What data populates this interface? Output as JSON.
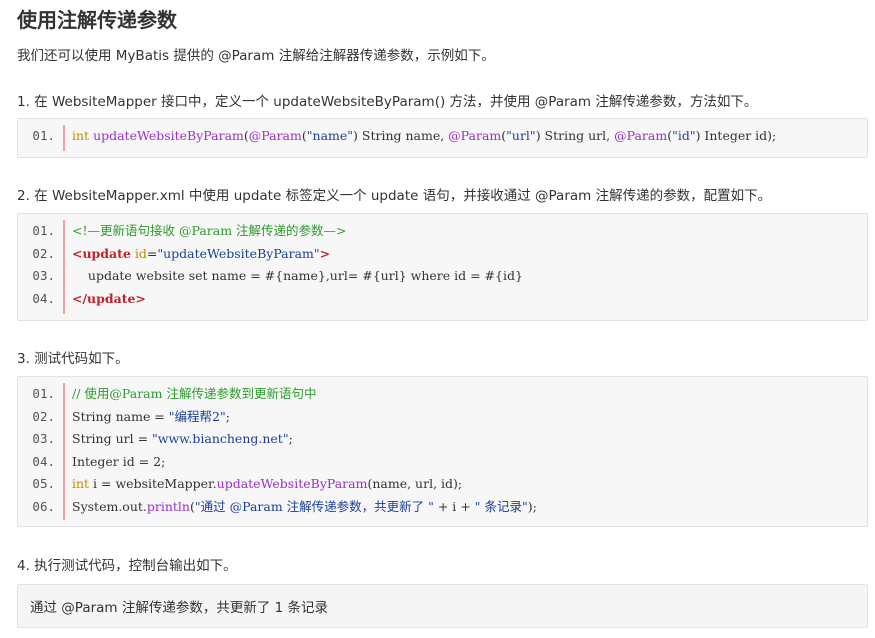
{
  "title": "使用注解传递参数",
  "intro": "我们还可以使用 MyBatis 提供的 @Param 注解给注解器传递参数，示例如下。",
  "steps": [
    {
      "text": "1. 在 WebsiteMapper 接口中，定义一个 updateWebsiteByParam() 方法，并使用 @Param 注解传递参数，方法如下。",
      "code": [
        {
          "num": "01.",
          "tokens": [
            {
              "t": "int",
              "c": "type"
            },
            {
              "t": " ",
              "c": "plain"
            },
            {
              "t": "updateWebsiteByParam",
              "c": "fn"
            },
            {
              "t": "(",
              "c": "plain"
            },
            {
              "t": "@Param",
              "c": "ann"
            },
            {
              "t": "(",
              "c": "plain"
            },
            {
              "t": "\"name\"",
              "c": "str"
            },
            {
              "t": ") String name, ",
              "c": "plain"
            },
            {
              "t": "@Param",
              "c": "ann"
            },
            {
              "t": "(",
              "c": "plain"
            },
            {
              "t": "\"url\"",
              "c": "str"
            },
            {
              "t": ") String url, ",
              "c": "plain"
            },
            {
              "t": "@Param",
              "c": "ann"
            },
            {
              "t": "(",
              "c": "plain"
            },
            {
              "t": "\"id\"",
              "c": "str"
            },
            {
              "t": ") Integer id);",
              "c": "plain"
            }
          ]
        }
      ]
    },
    {
      "text": "2. 在 WebsiteMapper.xml 中使用 update 标签定义一个 update 语句，并接收通过 @Param 注解传递的参数，配置如下。",
      "code": [
        {
          "num": "01.",
          "tokens": [
            {
              "t": "<!—更新语句接收 @Param 注解传递的参数—>",
              "c": "cmt"
            }
          ]
        },
        {
          "num": "02.",
          "tokens": [
            {
              "t": "<update",
              "c": "tag"
            },
            {
              "t": " ",
              "c": "plain"
            },
            {
              "t": "id",
              "c": "attr"
            },
            {
              "t": "=",
              "c": "plain"
            },
            {
              "t": "\"updateWebsiteByParam\"",
              "c": "str"
            },
            {
              "t": ">",
              "c": "tag"
            }
          ]
        },
        {
          "num": "03.",
          "tokens": [
            {
              "t": "    update website set name = #{name},url= #{url} where id = #{id}",
              "c": "plain"
            }
          ]
        },
        {
          "num": "04.",
          "tokens": [
            {
              "t": "</update>",
              "c": "tag"
            }
          ]
        }
      ]
    },
    {
      "text": "3. 测试代码如下。",
      "code": [
        {
          "num": "01.",
          "tokens": [
            {
              "t": "// 使用@Param 注解传递参数到更新语句中",
              "c": "cmt"
            }
          ]
        },
        {
          "num": "02.",
          "tokens": [
            {
              "t": "String name = ",
              "c": "plain"
            },
            {
              "t": "\"编程帮2\"",
              "c": "str"
            },
            {
              "t": ";",
              "c": "plain"
            }
          ]
        },
        {
          "num": "03.",
          "tokens": [
            {
              "t": "String url = ",
              "c": "plain"
            },
            {
              "t": "\"www.biancheng.net\"",
              "c": "str"
            },
            {
              "t": ";",
              "c": "plain"
            }
          ]
        },
        {
          "num": "04.",
          "tokens": [
            {
              "t": "Integer id = 2;",
              "c": "plain"
            }
          ]
        },
        {
          "num": "05.",
          "tokens": [
            {
              "t": "int",
              "c": "type"
            },
            {
              "t": " i = websiteMapper.",
              "c": "plain"
            },
            {
              "t": "updateWebsiteByParam",
              "c": "fn"
            },
            {
              "t": "(name, url, id);",
              "c": "plain"
            }
          ]
        },
        {
          "num": "06.",
          "tokens": [
            {
              "t": "System.out.",
              "c": "plain"
            },
            {
              "t": "println",
              "c": "fn"
            },
            {
              "t": "(",
              "c": "plain"
            },
            {
              "t": "\"通过 @Param 注解传递参数，共更新了 \"",
              "c": "str"
            },
            {
              "t": " + i + ",
              "c": "plain"
            },
            {
              "t": "\" 条记录\"",
              "c": "str"
            },
            {
              "t": ");",
              "c": "plain"
            }
          ]
        }
      ]
    },
    {
      "text": "4. 执行测试代码，控制台输出如下。",
      "output": "通过 @Param 注解传递参数，共更新了 1 条记录"
    }
  ]
}
